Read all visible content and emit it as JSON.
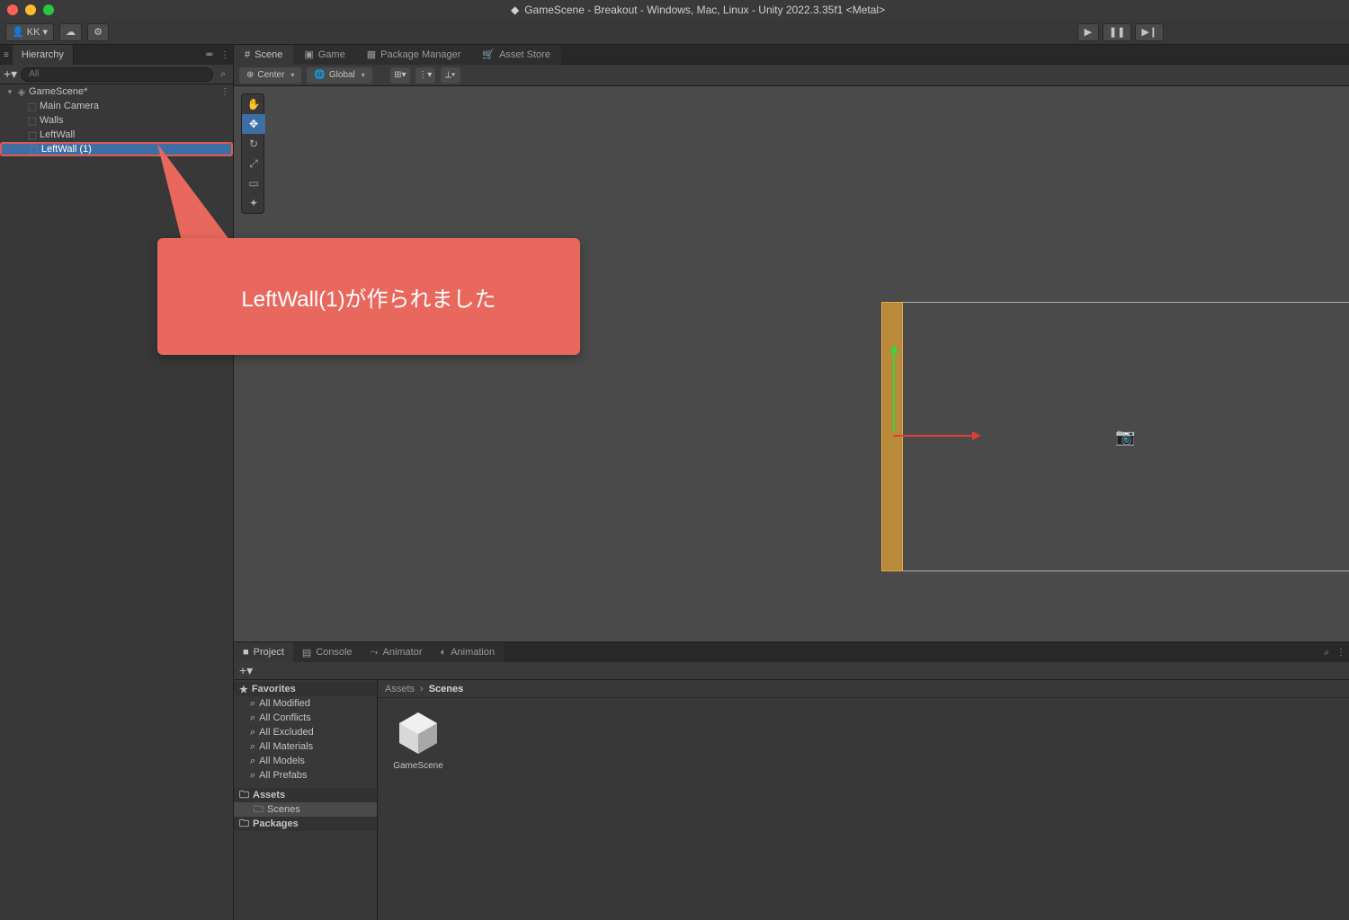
{
  "window": {
    "title": "GameScene - Breakout - Windows, Mac, Linux - Unity 2022.3.35f1 <Metal>"
  },
  "account": {
    "label": "KK"
  },
  "hierarchy": {
    "tab": "Hierarchy",
    "search_placeholder": "All",
    "root": "GameScene*",
    "items": [
      "Main Camera",
      "Walls",
      "LeftWall",
      "LeftWall (1)"
    ]
  },
  "scene_tabs": {
    "scene": "Scene",
    "game": "Game",
    "package_manager": "Package Manager",
    "asset_store": "Asset Store"
  },
  "scene_toolbar": {
    "pivot": "Center",
    "space": "Global"
  },
  "callout": {
    "text": "LeftWall(1)が作られました"
  },
  "bottom": {
    "tabs": {
      "project": "Project",
      "console": "Console",
      "animator": "Animator",
      "animation": "Animation"
    },
    "favorites": {
      "header": "Favorites",
      "items": [
        "All Modified",
        "All Conflicts",
        "All Excluded",
        "All Materials",
        "All Models",
        "All Prefabs"
      ]
    },
    "assets_header": "Assets",
    "scenes_folder": "Scenes",
    "packages": "Packages",
    "breadcrumb": {
      "root": "Assets",
      "current": "Scenes"
    },
    "asset": {
      "name": "GameScene"
    }
  }
}
